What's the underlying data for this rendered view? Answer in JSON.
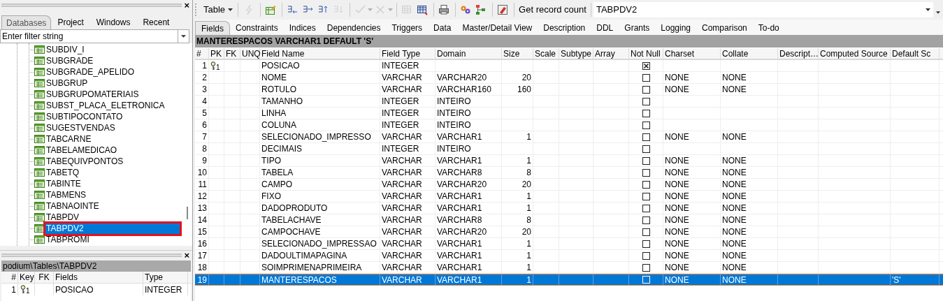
{
  "left_panel": {
    "tabs": [
      {
        "label": "Databases",
        "selected": true
      },
      {
        "label": "Project",
        "selected": false
      },
      {
        "label": "Windows",
        "selected": false
      },
      {
        "label": "Recent",
        "selected": false
      }
    ],
    "filter": {
      "placeholder": "Enter filter string"
    },
    "close": "×",
    "tree": {
      "items": [
        {
          "label": "SUBDIV_I",
          "selected": false,
          "highlighted": false
        },
        {
          "label": "SUBGRADE",
          "selected": false,
          "highlighted": false
        },
        {
          "label": "SUBGRADE_APELIDO",
          "selected": false,
          "highlighted": false
        },
        {
          "label": "SUBGRUP",
          "selected": false,
          "highlighted": false
        },
        {
          "label": "SUBGRUPOMATERIAIS",
          "selected": false,
          "highlighted": false
        },
        {
          "label": "SUBST_PLACA_ELETRONICA",
          "selected": false,
          "highlighted": false
        },
        {
          "label": "SUBTIPOCONTATO",
          "selected": false,
          "highlighted": false
        },
        {
          "label": "SUGESTVENDAS",
          "selected": false,
          "highlighted": false
        },
        {
          "label": "TABCARNE",
          "selected": false,
          "highlighted": false
        },
        {
          "label": "TABELAMEDICAO",
          "selected": false,
          "highlighted": false
        },
        {
          "label": "TABEQUIVPONTOS",
          "selected": false,
          "highlighted": false
        },
        {
          "label": "TABETQ",
          "selected": false,
          "highlighted": false
        },
        {
          "label": "TABINTE",
          "selected": false,
          "highlighted": false
        },
        {
          "label": "TABMENS",
          "selected": false,
          "highlighted": false
        },
        {
          "label": "TABNAOINTE",
          "selected": false,
          "highlighted": false
        },
        {
          "label": "TABPDV",
          "selected": false,
          "highlighted": false
        },
        {
          "label": "TABPDV2",
          "selected": true,
          "highlighted": true
        },
        {
          "label": "TABPROMI",
          "selected": false,
          "highlighted": false
        }
      ]
    }
  },
  "fields_panel": {
    "close": "×",
    "path": "podium\\Tables\\TABPDV2",
    "columns": [
      "#",
      "Key",
      "FK",
      "Fields",
      "Type"
    ],
    "rows": [
      {
        "num": "1",
        "key": "1",
        "field": "POSICAO",
        "type": "INTEGER"
      }
    ]
  },
  "toolbar": {
    "menu_button": "Table",
    "icons": [
      {
        "disabled": true
      },
      {
        "disabled": false
      },
      {
        "disabled": false
      },
      {
        "disabled": false
      },
      {
        "disabled": false
      },
      {
        "disabled": true
      },
      {
        "disabled": true
      },
      {
        "disabled": true
      },
      {
        "disabled": true
      },
      {
        "disabled": false
      },
      {
        "disabled": false
      },
      {
        "disabled": false
      },
      {
        "disabled": false
      },
      {
        "disabled": false
      }
    ],
    "record_count_button": "Get record count",
    "object_combo": "TABPDV2"
  },
  "tabs": [
    {
      "label": "Fields",
      "selected": true
    },
    {
      "label": "Constraints",
      "selected": false
    },
    {
      "label": "Indices",
      "selected": false
    },
    {
      "label": "Dependencies",
      "selected": false
    },
    {
      "label": "Triggers",
      "selected": false
    },
    {
      "label": "Data",
      "selected": false
    },
    {
      "label": "Master/Detail View",
      "selected": false
    },
    {
      "label": "Description",
      "selected": false
    },
    {
      "label": "DDL",
      "selected": false
    },
    {
      "label": "Grants",
      "selected": false
    },
    {
      "label": "Logging",
      "selected": false
    },
    {
      "label": "Comparison",
      "selected": false
    },
    {
      "label": "To-do",
      "selected": false
    }
  ],
  "caption": "MANTERESPACOS VARCHAR1 DEFAULT 'S'",
  "table": {
    "columns": [
      "#",
      "PK",
      "FK",
      "UNQ",
      "Field Name",
      "Field Type",
      "Domain",
      "Size",
      "Scale",
      "Subtype",
      "Array",
      "Not Null",
      "Charset",
      "Collate",
      "Descript…",
      "Computed Source",
      "Default Sc"
    ],
    "rows": [
      {
        "num": "1",
        "pk": "1",
        "name": "POSICAO",
        "type": "INTEGER",
        "not_null": true,
        "selected": false
      },
      {
        "num": "2",
        "name": "NOME",
        "type": "VARCHAR",
        "domain": "VARCHAR20",
        "size": "20",
        "not_null": false,
        "charset": "NONE",
        "collate": "NONE",
        "selected": false
      },
      {
        "num": "3",
        "name": "ROTULO",
        "type": "VARCHAR",
        "domain": "VARCHAR160",
        "size": "160",
        "not_null": false,
        "charset": "NONE",
        "collate": "NONE",
        "selected": false
      },
      {
        "num": "4",
        "name": "TAMANHO",
        "type": "INTEGER",
        "domain": "INTEIRO",
        "not_null": false,
        "selected": false
      },
      {
        "num": "5",
        "name": "LINHA",
        "type": "INTEGER",
        "domain": "INTEIRO",
        "not_null": false,
        "selected": false
      },
      {
        "num": "6",
        "name": "COLUNA",
        "type": "INTEGER",
        "domain": "INTEIRO",
        "not_null": false,
        "selected": false
      },
      {
        "num": "7",
        "name": "SELECIONADO_IMPRESSO",
        "type": "VARCHAR",
        "domain": "VARCHAR1",
        "size": "1",
        "not_null": false,
        "charset": "NONE",
        "collate": "NONE",
        "selected": false
      },
      {
        "num": "8",
        "name": "DECIMAIS",
        "type": "INTEGER",
        "domain": "INTEIRO",
        "not_null": false,
        "selected": false
      },
      {
        "num": "9",
        "name": "TIPO",
        "type": "VARCHAR",
        "domain": "VARCHAR1",
        "size": "1",
        "not_null": false,
        "charset": "NONE",
        "collate": "NONE",
        "selected": false
      },
      {
        "num": "10",
        "name": "TABELA",
        "type": "VARCHAR",
        "domain": "VARCHAR8",
        "size": "8",
        "not_null": false,
        "charset": "NONE",
        "collate": "NONE",
        "selected": false
      },
      {
        "num": "11",
        "name": "CAMPO",
        "type": "VARCHAR",
        "domain": "VARCHAR20",
        "size": "20",
        "not_null": false,
        "charset": "NONE",
        "collate": "NONE",
        "selected": false
      },
      {
        "num": "12",
        "name": "FIXO",
        "type": "VARCHAR",
        "domain": "VARCHAR1",
        "size": "1",
        "not_null": false,
        "charset": "NONE",
        "collate": "NONE",
        "selected": false
      },
      {
        "num": "13",
        "name": "DADOPRODUTO",
        "type": "VARCHAR",
        "domain": "VARCHAR1",
        "size": "1",
        "not_null": false,
        "charset": "NONE",
        "collate": "NONE",
        "selected": false
      },
      {
        "num": "14",
        "name": "TABELACHAVE",
        "type": "VARCHAR",
        "domain": "VARCHAR8",
        "size": "8",
        "not_null": false,
        "charset": "NONE",
        "collate": "NONE",
        "selected": false
      },
      {
        "num": "15",
        "name": "CAMPOCHAVE",
        "type": "VARCHAR",
        "domain": "VARCHAR20",
        "size": "20",
        "not_null": false,
        "charset": "NONE",
        "collate": "NONE",
        "selected": false
      },
      {
        "num": "16",
        "name": "SELECIONADO_IMPRESSAO",
        "type": "VARCHAR",
        "domain": "VARCHAR1",
        "size": "1",
        "not_null": false,
        "charset": "NONE",
        "collate": "NONE",
        "selected": false
      },
      {
        "num": "17",
        "name": "DADOULTIMAPAGINA",
        "type": "VARCHAR",
        "domain": "VARCHAR1",
        "size": "1",
        "not_null": false,
        "charset": "NONE",
        "collate": "NONE",
        "selected": false
      },
      {
        "num": "18",
        "name": "SOIMPRIMENAPRIMEIRA",
        "type": "VARCHAR",
        "domain": "VARCHAR1",
        "size": "1",
        "not_null": false,
        "charset": "NONE",
        "collate": "NONE",
        "selected": false
      },
      {
        "num": "19",
        "name": "MANTERESPACOS",
        "type": "VARCHAR",
        "domain": "VARCHAR1",
        "size": "1",
        "not_null": false,
        "charset": "NONE",
        "collate": "NONE",
        "default": "'S'",
        "selected": true
      }
    ]
  }
}
